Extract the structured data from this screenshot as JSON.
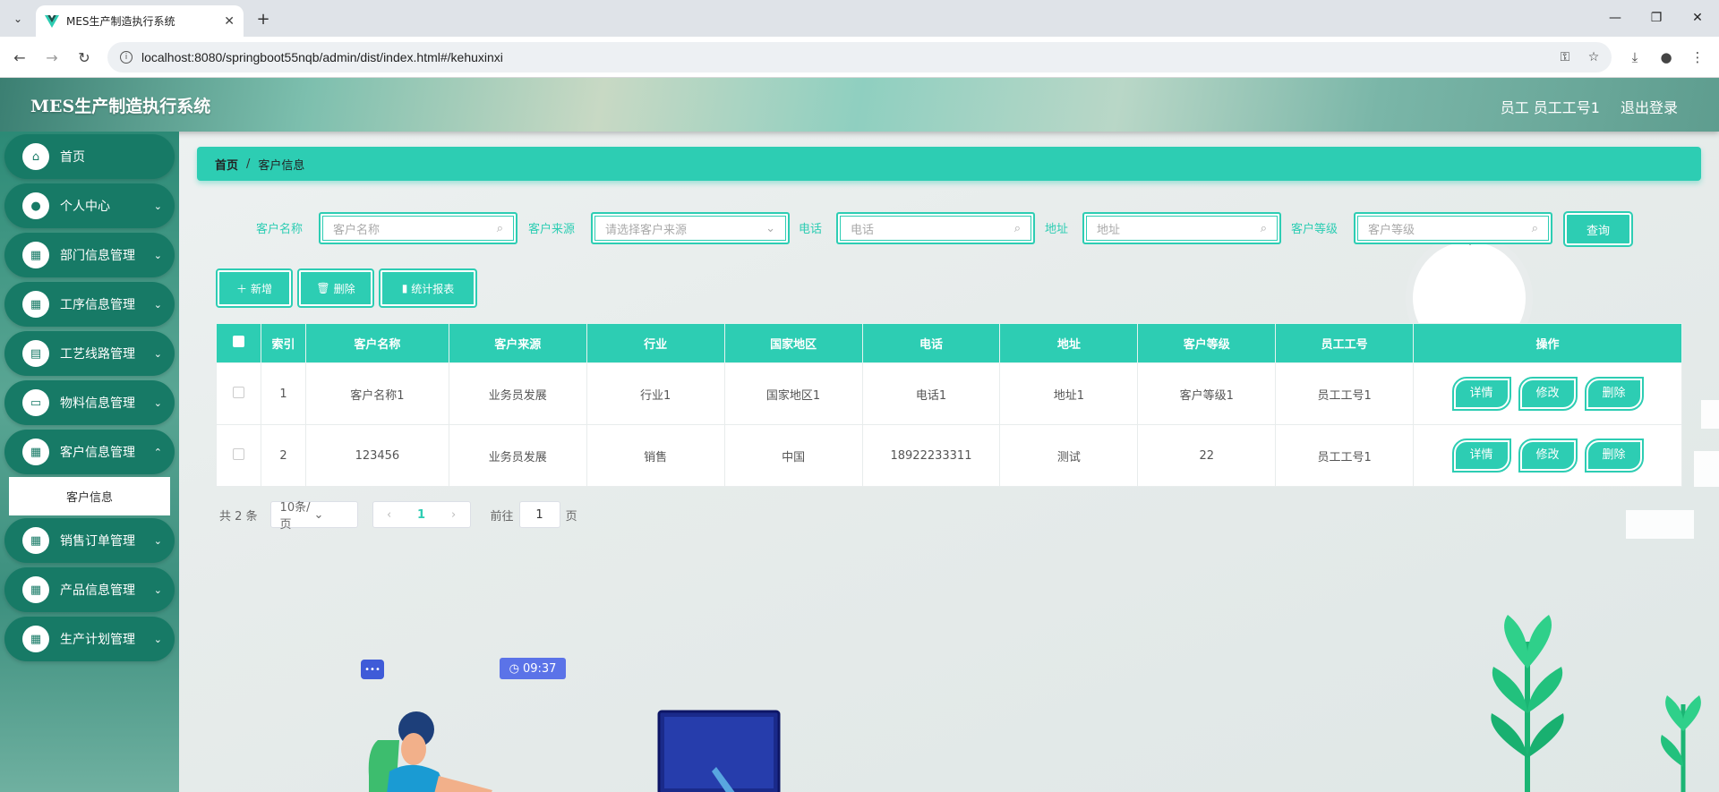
{
  "browser": {
    "tab_title": "MES生产制造执行系统",
    "url": "localhost:8080/springboot55nqb/admin/dist/index.html#/kehuxinxi"
  },
  "header": {
    "brand": "MES生产制造执行系统",
    "user": "员工 员工工号1",
    "logout": "退出登录"
  },
  "sidebar": {
    "items": [
      {
        "label": "首页",
        "icon": "home-icon"
      },
      {
        "label": "个人中心",
        "icon": "user-icon"
      },
      {
        "label": "部门信息管理",
        "icon": "grid-icon"
      },
      {
        "label": "工序信息管理",
        "icon": "grid-icon"
      },
      {
        "label": "工艺线路管理",
        "icon": "clipboard-icon"
      },
      {
        "label": "物料信息管理",
        "icon": "monitor-icon"
      },
      {
        "label": "客户信息管理",
        "icon": "grid-icon"
      },
      {
        "label": "销售订单管理",
        "icon": "grid-icon"
      },
      {
        "label": "产品信息管理",
        "icon": "grid-icon"
      },
      {
        "label": "生产计划管理",
        "icon": "grid-icon"
      }
    ],
    "submenu_active": "客户信息"
  },
  "breadcrumb": {
    "home": "首页",
    "sep": "/",
    "current": "客户信息"
  },
  "search": {
    "name_label": "客户名称",
    "name_placeholder": "客户名称",
    "source_label": "客户来源",
    "source_placeholder": "请选择客户来源",
    "phone_label": "电话",
    "phone_placeholder": "电话",
    "address_label": "地址",
    "address_placeholder": "地址",
    "level_label": "客户等级",
    "level_placeholder": "客户等级",
    "query_button": "查询"
  },
  "actions": {
    "add": "新增",
    "delete": "删除",
    "report": "统计报表"
  },
  "table": {
    "headers": [
      "索引",
      "客户名称",
      "客户来源",
      "行业",
      "国家地区",
      "电话",
      "地址",
      "客户等级",
      "员工工号",
      "操作"
    ],
    "rows": [
      [
        "1",
        "客户名称1",
        "业务员发展",
        "行业1",
        "国家地区1",
        "电话1",
        "地址1",
        "客户等级1",
        "员工工号1"
      ],
      [
        "2",
        "123456",
        "业务员发展",
        "销售",
        "中国",
        "18922233311",
        "测试",
        "22",
        "员工工号1"
      ]
    ],
    "op_detail": "详情",
    "op_edit": "修改",
    "op_delete": "删除"
  },
  "pager": {
    "total": "共 2 条",
    "size": "10条/页",
    "current": "1",
    "goto": "前往",
    "goto_value": "1",
    "page": "页"
  },
  "illustration": {
    "time": "09:37"
  },
  "colors": {
    "accent": "#2dcdb3",
    "sidebar_item": "#177a66"
  }
}
